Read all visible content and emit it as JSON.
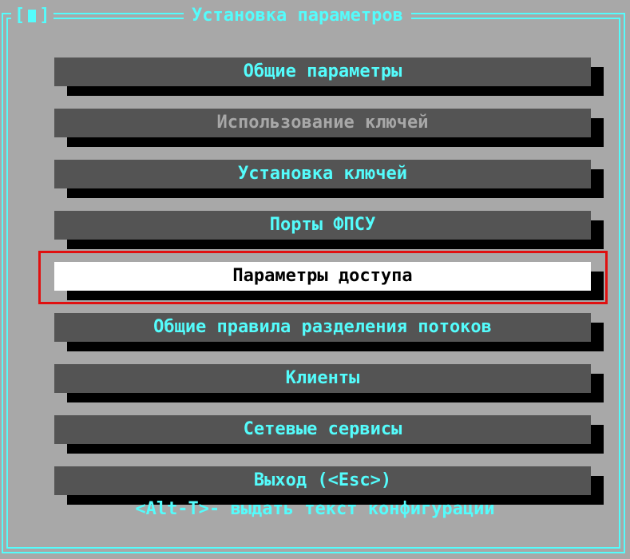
{
  "window": {
    "title": "Установка параметров",
    "close_glyph": "[▮]"
  },
  "menu": {
    "items": [
      {
        "label": "Общие параметры",
        "state": "normal"
      },
      {
        "label": "Использование ключей",
        "state": "disabled"
      },
      {
        "label": "Установка ключей",
        "state": "normal"
      },
      {
        "label": "Порты ФПСУ",
        "state": "normal"
      },
      {
        "label": "Параметры доступа",
        "state": "selected"
      },
      {
        "label": "Общие правила разделения потоков",
        "state": "normal"
      },
      {
        "label": "Клиенты",
        "state": "normal"
      },
      {
        "label": "Сетевые сервисы",
        "state": "normal"
      },
      {
        "label": "Выход (<Esc>)",
        "state": "normal"
      }
    ]
  },
  "hint": "<Alt-T>- выдать текст конфигурации",
  "colors": {
    "background": "#a8a8a8",
    "frame": "#54fcfc",
    "button": "#545454",
    "button_text": "#54fcfc",
    "disabled_text": "#a8a8a8",
    "selected_bg": "#ffffff",
    "selected_text": "#000000",
    "highlight": "#e01010"
  }
}
